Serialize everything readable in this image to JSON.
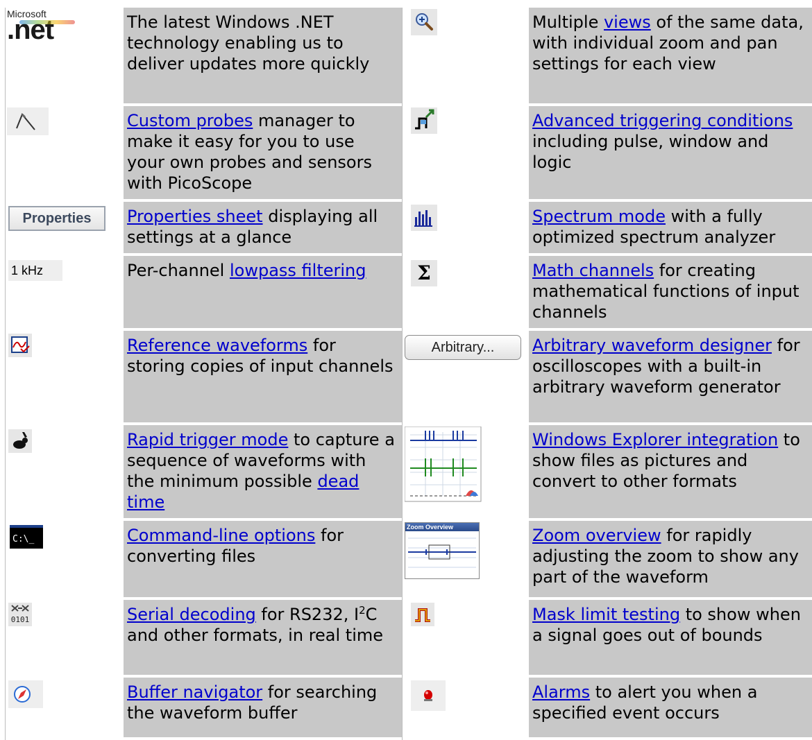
{
  "rows": [
    {
      "left": {
        "icon": "dotnet-logo",
        "logo_top": "Microsoft",
        "logo_main": ".net",
        "pre": "The latest Windows .NET technology enabling us to deliver updates more quickly",
        "link": "",
        "post": ""
      },
      "right": {
        "icon": "zoom-magnifier-icon",
        "pre": "Multiple ",
        "link": "views",
        "post": " of the same data, with individual zoom and pan settings for each view"
      }
    },
    {
      "left": {
        "icon": "probe-icon",
        "pre": "",
        "link": "Custom probes",
        "post": " manager to make it easy for you to use your own probes and sensors with PicoScope"
      },
      "right": {
        "icon": "trigger-icon",
        "pre": "",
        "link": "Advanced triggering conditions",
        "post": " including pulse, window and logic"
      }
    },
    {
      "left": {
        "icon": "properties-button",
        "icon_text": "Properties",
        "pre": "",
        "link": "Properties sheet",
        "post": " displaying all settings at a glance"
      },
      "right": {
        "icon": "spectrum-icon",
        "pre": "",
        "link": "Spectrum mode",
        "post": " with a fully optimized spectrum analyzer"
      }
    },
    {
      "left": {
        "icon": "lowpass-label",
        "icon_text": "1 kHz",
        "pre": "Per-channel ",
        "link": "lowpass filtering",
        "post": ""
      },
      "right": {
        "icon": "sigma-icon",
        "icon_text": "Σ",
        "pre": "",
        "link": "Math channels",
        "post": " for creating mathematical functions of input channels"
      }
    },
    {
      "left": {
        "icon": "reference-waveform-icon",
        "pre": "",
        "link": "Reference waveforms",
        "post": " for storing copies of input channels"
      },
      "right": {
        "icon": "arbitrary-button",
        "icon_text": "Arbitrary...",
        "pre": "",
        "link": "Arbitrary waveform designer",
        "post": " for oscilloscopes with a built-in arbitrary waveform generator"
      }
    },
    {
      "left": {
        "icon": "rabbit-icon",
        "pre": "",
        "link": "Rapid trigger mode",
        "post": " to capture a sequence of waveforms with the minimum possible ",
        "link2": "dead time",
        "post2": ""
      },
      "right": {
        "icon": "explorer-thumbnail",
        "pre": "",
        "link": "Windows Explorer integration",
        "post": " to show files as pictures and convert to other formats"
      }
    },
    {
      "left": {
        "icon": "command-prompt-icon",
        "icon_text": "C:\\_",
        "pre": "",
        "link": "Command-line options",
        "post": " for converting files"
      },
      "right": {
        "icon": "zoom-overview-thumbnail",
        "icon_text": "Zoom Overview",
        "pre": "",
        "link": "Zoom overview",
        "post": " for rapidly adjusting the zoom to show any part of the waveform"
      }
    },
    {
      "left": {
        "icon": "serial-decode-icon",
        "icon_text": "0101",
        "pre": "",
        "link": "Serial decoding",
        "post": " for RS232, I",
        "sup": "2",
        "post2": "C and other formats, in real time"
      },
      "right": {
        "icon": "mask-icon",
        "pre": "",
        "link": "Mask limit testing",
        "post": " to show when a signal goes out of bounds"
      }
    },
    {
      "left": {
        "icon": "compass-icon",
        "pre": "",
        "link": "Buffer navigator",
        "post": " for searching the waveform buffer"
      },
      "right": {
        "icon": "alarm-light-icon",
        "pre": "",
        "link": "Alarms",
        "post": " to alert you when a specified event occurs"
      }
    }
  ]
}
